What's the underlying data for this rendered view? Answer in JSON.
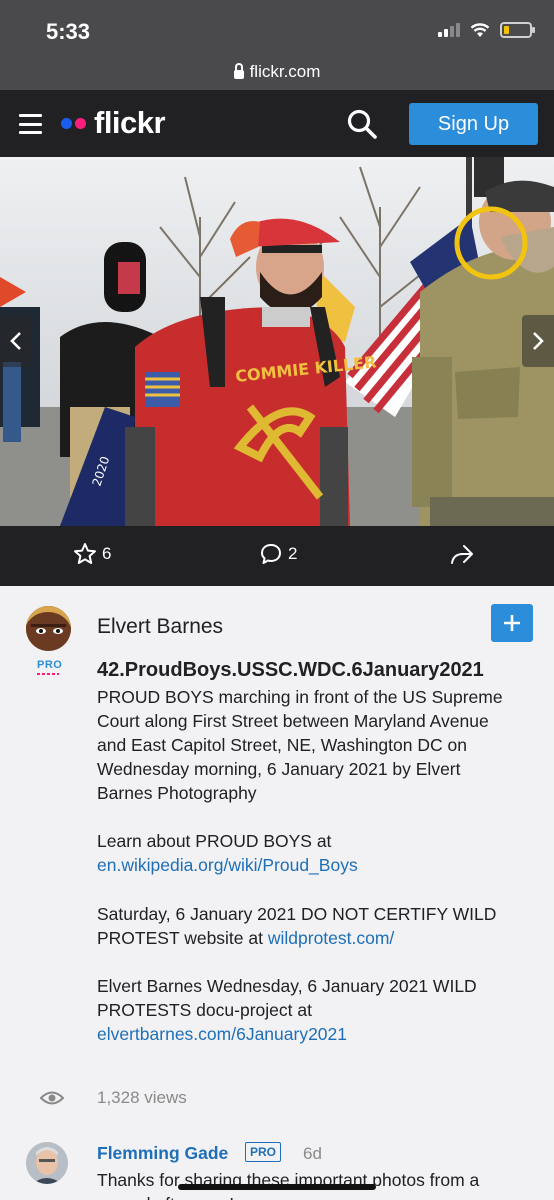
{
  "status_bar": {
    "time": "5:33"
  },
  "browser": {
    "url": "flickr.com"
  },
  "header": {
    "logo_text": "flickr",
    "signup_label": "Sign Up"
  },
  "photo": {
    "shirt_text": "COMMIE KILLER",
    "flag_text": "2020"
  },
  "actions": {
    "favorites": "6",
    "comments": "2"
  },
  "owner": {
    "name": "Elvert Barnes",
    "pro_label": "PRO",
    "title": "42.ProudBoys.USSC.WDC.6January2021"
  },
  "description": {
    "p1": "PROUD BOYS marching in front of the US Supreme Court along First Street between Maryland Avenue and East Capitol Street, NE, Washington DC on Wednesday morning, 6 January 2021 by Elvert Barnes Photography",
    "p2_text": "Learn about PROUD BOYS at",
    "p2_link": "en.wikipedia.org/wiki/Proud_Boys",
    "p3_text": "Saturday, 6 January 2021 DO NOT CERTIFY WILD PROTEST website at ",
    "p3_link": "wildprotest.com/",
    "p4_text": "Elvert Barnes Wednesday, 6 January 2021 WILD PROTESTS docu-project at",
    "p4_link": "elvertbarnes.com/6January2021"
  },
  "stats": {
    "views": "1,328 views"
  },
  "comment": {
    "author": "Flemming Gade",
    "pro_label": "PRO",
    "age": "6d",
    "text": "Thanks for sharing these important photos from a surreal afternoon!"
  },
  "colors": {
    "accent": "#2c8ddb",
    "link": "#1e6fb8",
    "header_bg": "#212124",
    "highlight_circle": "#f2c40f"
  }
}
